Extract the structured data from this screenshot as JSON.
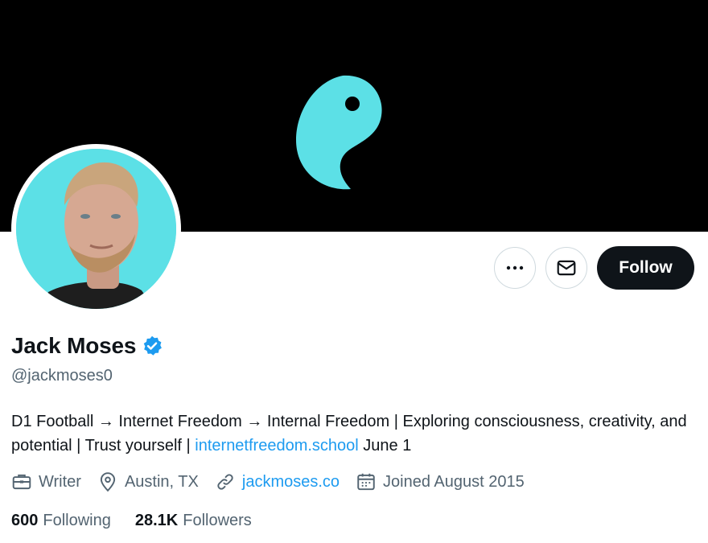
{
  "profile": {
    "name": "Jack Moses",
    "handle": "@jackmoses0",
    "verified": true,
    "bio_text_1": "D1 Football → Internet Freedom → Internal Freedom | Exploring consciousness, creativity, and potential | Trust yourself | ",
    "bio_link": "internetfreedom.school",
    "bio_text_2": " June 1",
    "profession": "Writer",
    "location": "Austin, TX",
    "website": "jackmoses.co",
    "joined": "Joined August 2015"
  },
  "stats": {
    "following_count": "600",
    "following_label": "Following",
    "followers_count": "28.1K",
    "followers_label": "Followers"
  },
  "actions": {
    "follow_label": "Follow"
  },
  "colors": {
    "accent": "#1d9bf0",
    "banner_bg": "#000000",
    "logo": "#5ce0e6",
    "avatar_bg": "#5ce0e6",
    "follow_bg": "#0f1419"
  },
  "icons": [
    "yin-yang-logo",
    "more-icon",
    "mail-icon",
    "verified-badge-icon",
    "briefcase-icon",
    "location-pin-icon",
    "link-icon",
    "calendar-icon"
  ]
}
